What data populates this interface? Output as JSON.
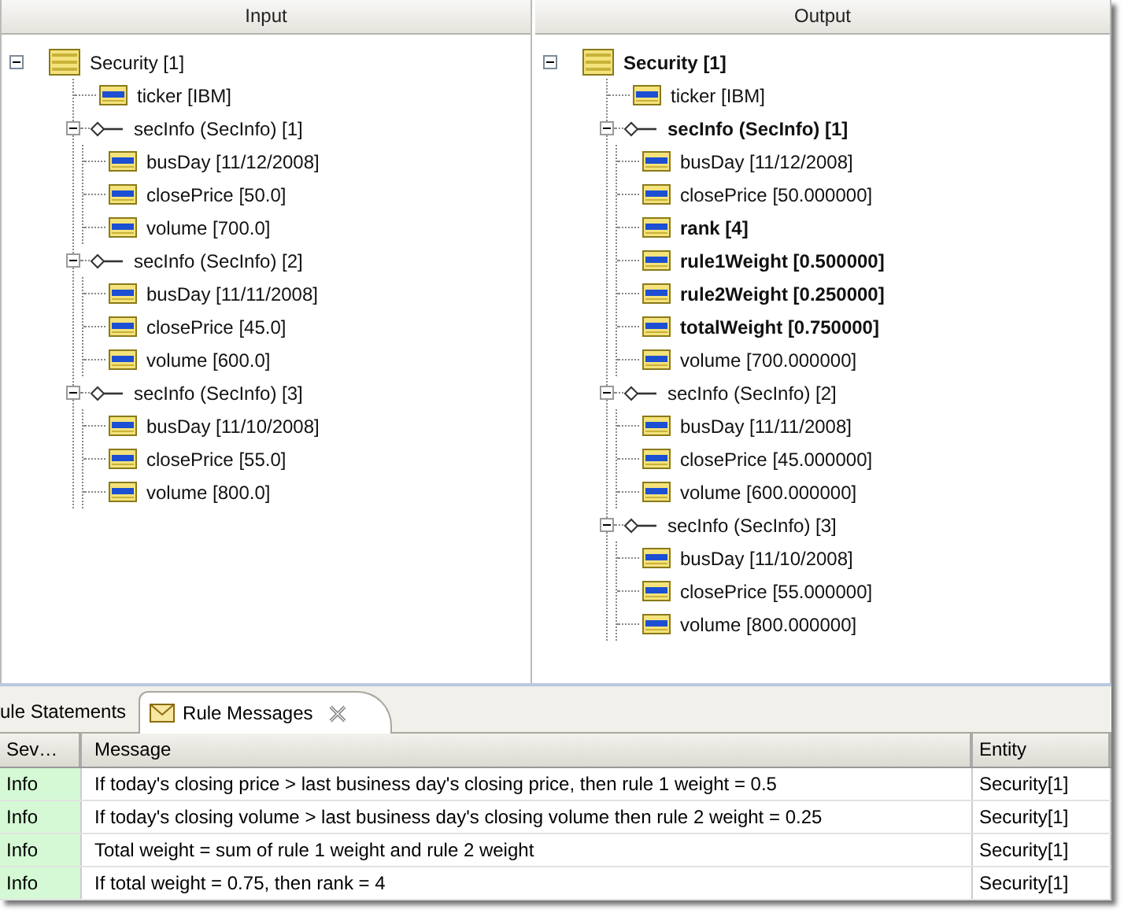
{
  "panels": [
    {
      "title": "Input",
      "tree": [
        {
          "label": "Security [1]",
          "kind": "entity",
          "bold": false,
          "expanded": true,
          "children": [
            {
              "label": "ticker [IBM]",
              "kind": "attribute",
              "bold": false
            },
            {
              "label": "secInfo (SecInfo) [1]",
              "kind": "relation",
              "bold": false,
              "expanded": true,
              "children": [
                {
                  "label": "busDay [11/12/2008]",
                  "kind": "attribute",
                  "bold": false
                },
                {
                  "label": "closePrice [50.0]",
                  "kind": "attribute",
                  "bold": false
                },
                {
                  "label": "volume [700.0]",
                  "kind": "attribute",
                  "bold": false
                }
              ]
            },
            {
              "label": "secInfo (SecInfo) [2]",
              "kind": "relation",
              "bold": false,
              "expanded": true,
              "children": [
                {
                  "label": "busDay [11/11/2008]",
                  "kind": "attribute",
                  "bold": false
                },
                {
                  "label": "closePrice [45.0]",
                  "kind": "attribute",
                  "bold": false
                },
                {
                  "label": "volume [600.0]",
                  "kind": "attribute",
                  "bold": false
                }
              ]
            },
            {
              "label": "secInfo (SecInfo) [3]",
              "kind": "relation",
              "bold": false,
              "expanded": true,
              "children": [
                {
                  "label": "busDay [11/10/2008]",
                  "kind": "attribute",
                  "bold": false
                },
                {
                  "label": "closePrice [55.0]",
                  "kind": "attribute",
                  "bold": false
                },
                {
                  "label": "volume [800.0]",
                  "kind": "attribute",
                  "bold": false
                }
              ]
            }
          ]
        }
      ]
    },
    {
      "title": "Output",
      "tree": [
        {
          "label": "Security [1]",
          "kind": "entity",
          "bold": true,
          "expanded": true,
          "children": [
            {
              "label": "ticker [IBM]",
              "kind": "attribute",
              "bold": false
            },
            {
              "label": "secInfo (SecInfo) [1]",
              "kind": "relation",
              "bold": true,
              "expanded": true,
              "children": [
                {
                  "label": "busDay [11/12/2008]",
                  "kind": "attribute",
                  "bold": false
                },
                {
                  "label": "closePrice [50.000000]",
                  "kind": "attribute",
                  "bold": false
                },
                {
                  "label": "rank [4]",
                  "kind": "attribute",
                  "bold": true
                },
                {
                  "label": "rule1Weight [0.500000]",
                  "kind": "attribute",
                  "bold": true
                },
                {
                  "label": "rule2Weight [0.250000]",
                  "kind": "attribute",
                  "bold": true
                },
                {
                  "label": "totalWeight [0.750000]",
                  "kind": "attribute",
                  "bold": true
                },
                {
                  "label": "volume [700.000000]",
                  "kind": "attribute",
                  "bold": false
                }
              ]
            },
            {
              "label": "secInfo (SecInfo) [2]",
              "kind": "relation",
              "bold": false,
              "expanded": true,
              "children": [
                {
                  "label": "busDay [11/11/2008]",
                  "kind": "attribute",
                  "bold": false
                },
                {
                  "label": "closePrice [45.000000]",
                  "kind": "attribute",
                  "bold": false
                },
                {
                  "label": "volume [600.000000]",
                  "kind": "attribute",
                  "bold": false
                }
              ]
            },
            {
              "label": "secInfo (SecInfo) [3]",
              "kind": "relation",
              "bold": false,
              "expanded": true,
              "children": [
                {
                  "label": "busDay [11/10/2008]",
                  "kind": "attribute",
                  "bold": false
                },
                {
                  "label": "closePrice [55.000000]",
                  "kind": "attribute",
                  "bold": false
                },
                {
                  "label": "volume [800.000000]",
                  "kind": "attribute",
                  "bold": false
                }
              ]
            }
          ]
        }
      ]
    }
  ],
  "tabs": [
    {
      "label": "ule Statements",
      "selected": false
    },
    {
      "label": "Rule Messages",
      "selected": true,
      "closable": true
    }
  ],
  "table": {
    "columns": [
      "Sev…",
      "Message",
      "Entity"
    ],
    "rows": [
      {
        "kind": "info",
        "severity": "Info",
        "message": "If today's closing price > last business day's closing price, then rule 1 weight = 0.5",
        "entity": "Security[1]"
      },
      {
        "kind": "info",
        "severity": "Info",
        "message": "If today's closing volume > last business day's closing volume then rule 2 weight = 0.25",
        "entity": "Security[1]"
      },
      {
        "kind": "info",
        "severity": "Info",
        "message": "Total weight = sum of rule 1 weight and rule 2 weight",
        "entity": "Security[1]"
      },
      {
        "kind": "info",
        "severity": "Info",
        "message": "If total weight = 0.75, then rank = 4",
        "entity": "Security[1]"
      }
    ]
  }
}
